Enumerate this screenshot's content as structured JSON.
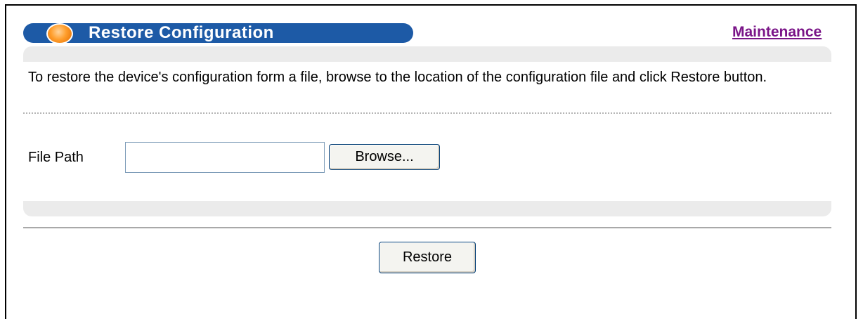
{
  "header": {
    "title": "Restore Configuration",
    "icon": "orb-icon",
    "bar_color": "#1d5aa6",
    "maintenance_link": "Maintenance",
    "link_color": "#7a1588"
  },
  "panel": {
    "description": "To restore the device's configuration form a file, browse to the location of the configuration file and click Restore button.",
    "file_path_label": "File Path",
    "file_path_value": "",
    "browse_label": "Browse..."
  },
  "actions": {
    "restore_label": "Restore"
  }
}
